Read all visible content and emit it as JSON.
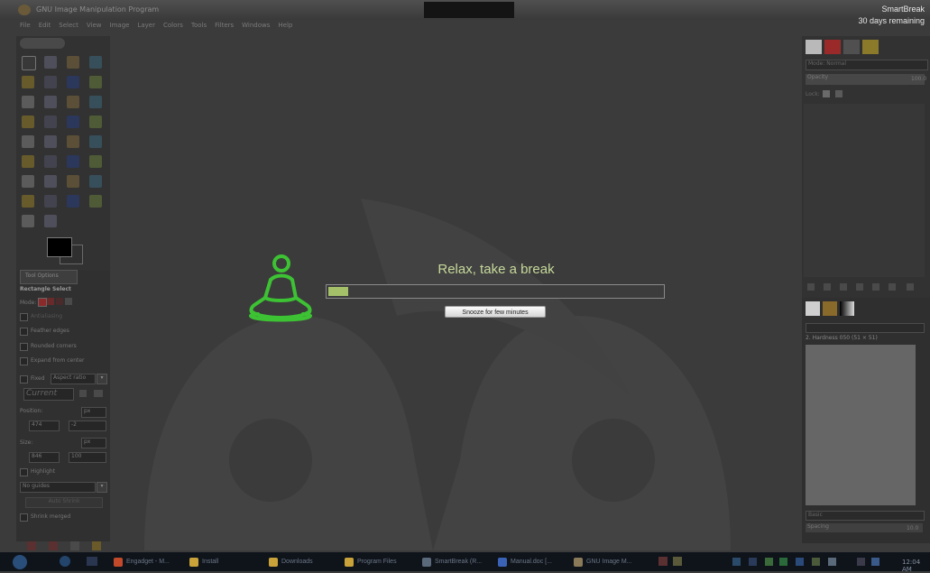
{
  "window": {
    "title": "GNU Image Manipulation Program"
  },
  "menu": [
    "File",
    "Edit",
    "Select",
    "View",
    "Image",
    "Layer",
    "Colors",
    "Tools",
    "Filters",
    "Windows",
    "Help"
  ],
  "smartbreak": {
    "app_name": "SmartBreak",
    "remaining": "30 days remaining",
    "message": "Relax, take a break",
    "progress_fraction": 0.06,
    "snooze_label": "Snooze for few minutes",
    "accent_color": "#a4c069",
    "icon_color": "#3dc234",
    "icon": "meditation-icon"
  },
  "tool_options": {
    "tab_label": "Tool Options",
    "title": "Rectangle Select",
    "mode_label": "Mode:",
    "antialiasing": "Antialiasing",
    "feather_edges": "Feather edges",
    "rounded_corners": "Rounded corners",
    "expand_from_center": "Expand from center",
    "fixed_label": "Fixed",
    "fixed_value": "Aspect ratio",
    "current": "Current",
    "position_label": "Position:",
    "position_unit": "px",
    "position_x": "474",
    "position_y": "-2",
    "size_label": "Size:",
    "size_unit": "px",
    "size_w": "846",
    "size_h": "100",
    "highlight": "Highlight",
    "guides": "No guides",
    "auto_shrink": "Auto Shrink",
    "shrink_merged": "Shrink merged"
  },
  "layers": {
    "mode_label": "Mode:",
    "mode_value": "Normal",
    "opacity_label": "Opacity",
    "opacity_value": "100.0",
    "lock_label": "Lock:"
  },
  "brushes": {
    "name": "2. Hardness 050 (51 × 51)",
    "tag": "Basic",
    "spacing_label": "Spacing",
    "spacing_value": "10.0"
  },
  "taskbar": {
    "items": [
      {
        "label": "Engadget - M...",
        "icon": "browser-icon",
        "color": "#c24a2a"
      },
      {
        "label": "Install",
        "icon": "folder-icon",
        "color": "#c9a23a"
      },
      {
        "label": "Downloads",
        "icon": "folder-icon",
        "color": "#c9a23a"
      },
      {
        "label": "Program Files",
        "icon": "folder-icon",
        "color": "#c9a23a"
      },
      {
        "label": "SmartBreak (R...",
        "icon": "app-icon",
        "color": "#5a6a7a"
      },
      {
        "label": "Manual.doc [...",
        "icon": "word-icon",
        "color": "#3a63b8"
      },
      {
        "label": "GNU Image M...",
        "icon": "gimp-icon",
        "color": "#8a7a5a"
      }
    ],
    "clock": "12:04 AM"
  }
}
